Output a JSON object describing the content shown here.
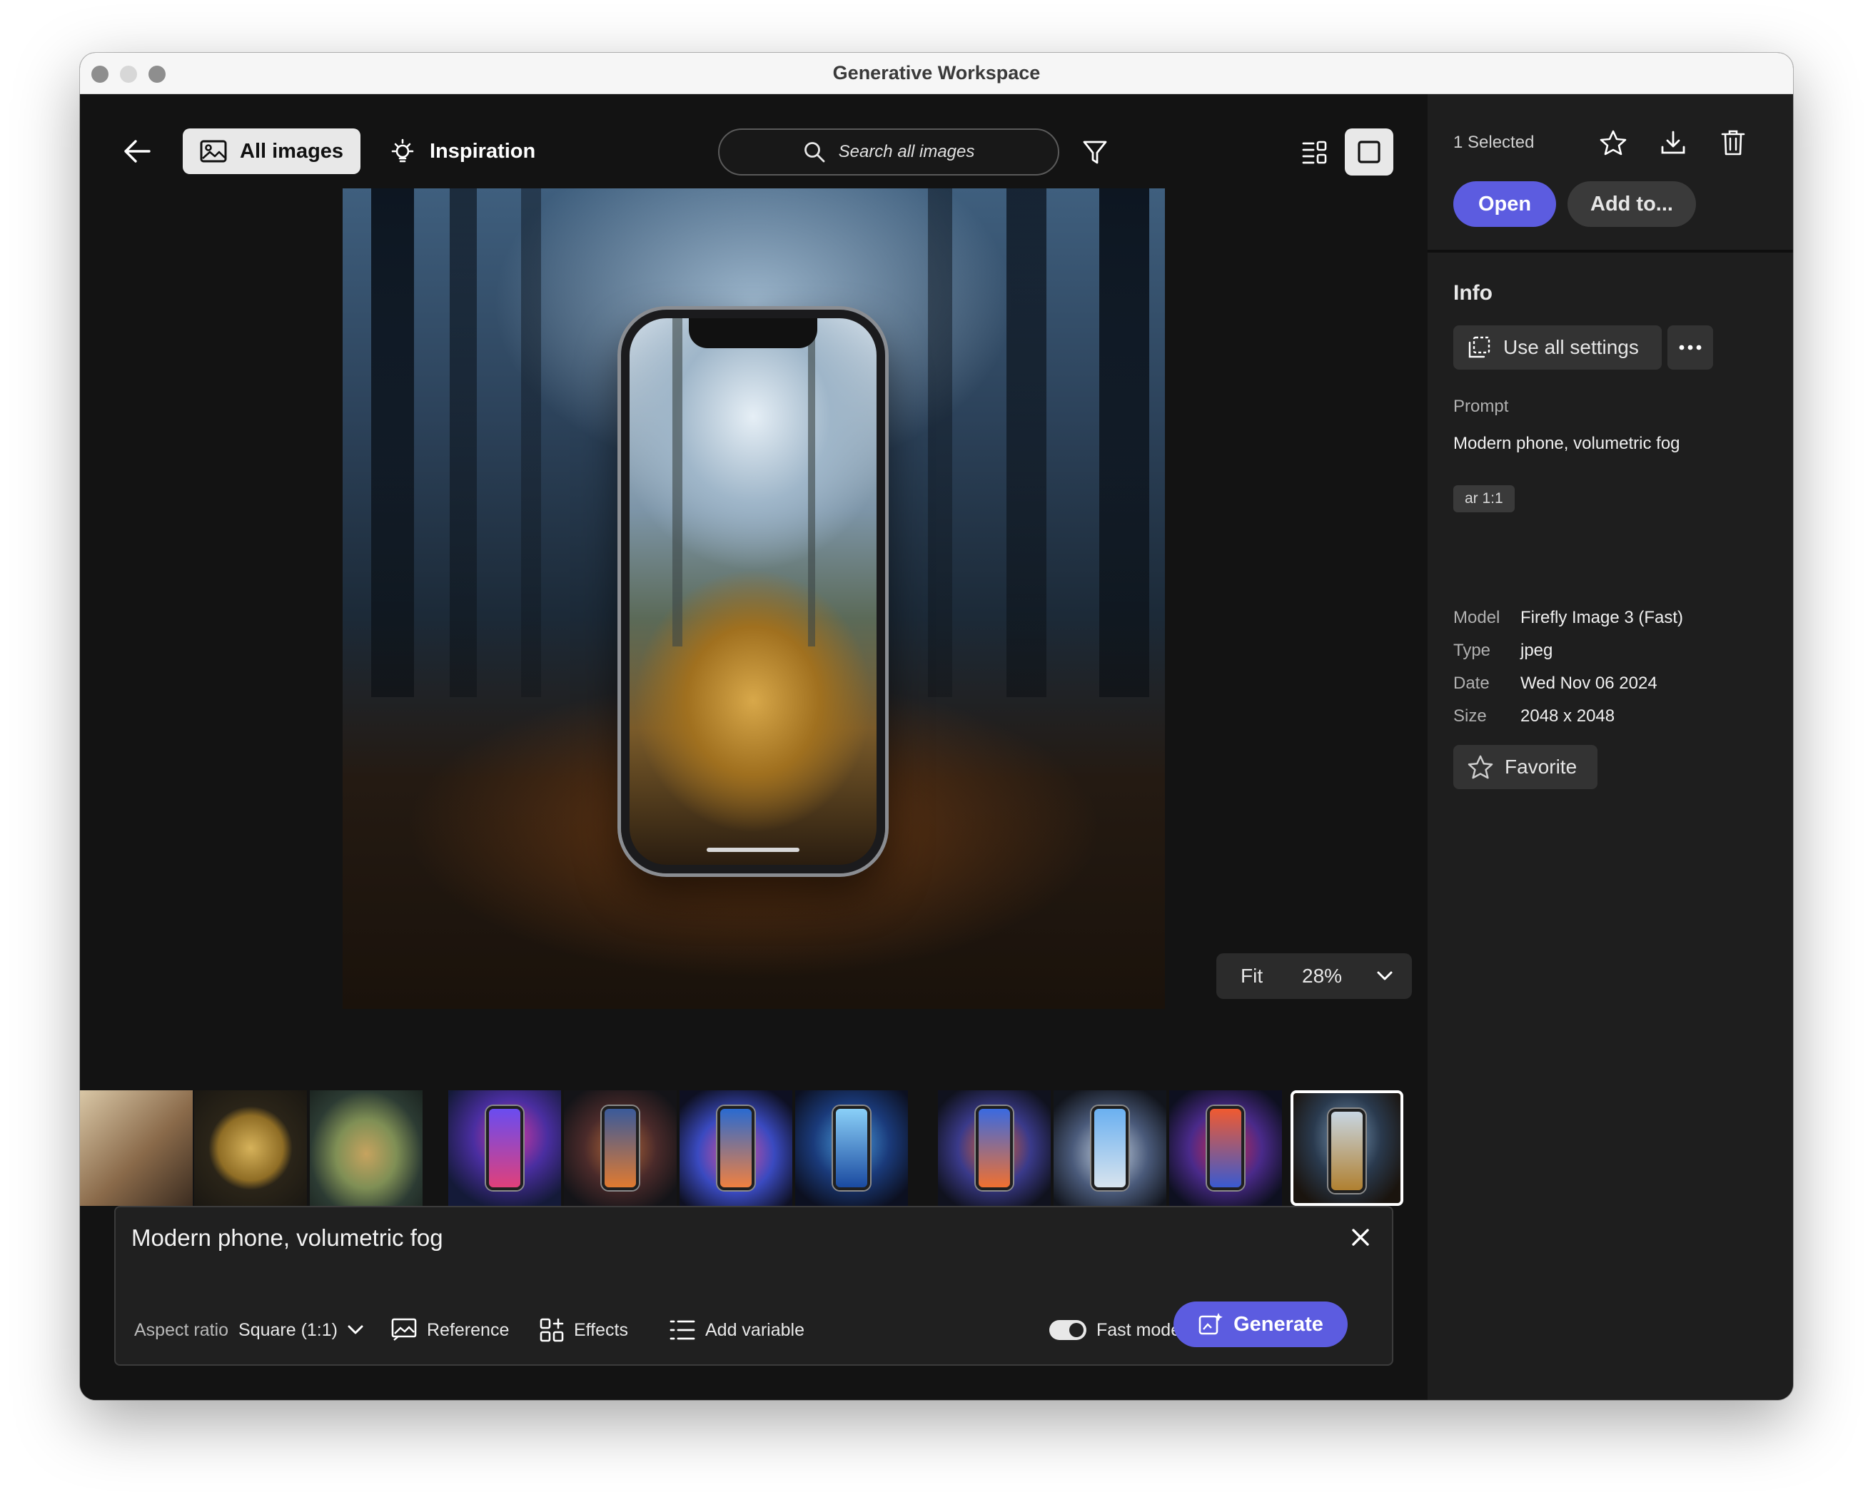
{
  "window": {
    "title": "Generative Workspace"
  },
  "toolbar": {
    "all_images_label": "All images",
    "inspiration_label": "Inspiration",
    "search_placeholder": "Search all images"
  },
  "viewer": {
    "fit_label": "Fit",
    "zoom_level": "28%"
  },
  "filmstrip": {
    "groups": [
      {
        "count": 3,
        "theme": "vintage-art"
      },
      {
        "count": 4,
        "theme": "phone-nebula"
      },
      {
        "count": 4,
        "theme": "phone-smoke"
      }
    ],
    "selected_index": 10
  },
  "prompt": {
    "text": "Modern phone, volumetric fog",
    "aspect_ratio_label": "Aspect ratio",
    "aspect_ratio_value": "Square (1:1)",
    "reference_label": "Reference",
    "effects_label": "Effects",
    "add_variable_label": "Add variable",
    "fast_mode_label": "Fast mode",
    "fast_mode_on": true,
    "generate_label": "Generate"
  },
  "panel": {
    "selected_text": "1 Selected",
    "open_label": "Open",
    "add_to_label": "Add to...",
    "info_title": "Info",
    "use_all_settings_label": "Use all settings",
    "prompt_label": "Prompt",
    "prompt_value": "Modern phone, volumetric fog",
    "tag": "ar 1:1",
    "details": [
      {
        "label": "Model",
        "value": "Firefly Image 3 (Fast)"
      },
      {
        "label": "Type",
        "value": "jpeg"
      },
      {
        "label": "Date",
        "value": "Wed Nov 06 2024"
      },
      {
        "label": "Size",
        "value": "2048 x 2048"
      }
    ],
    "favorite_label": "Favorite"
  },
  "colors": {
    "accent": "#5c5ce0",
    "background": "#131313",
    "panel": "#1e1e1e"
  }
}
